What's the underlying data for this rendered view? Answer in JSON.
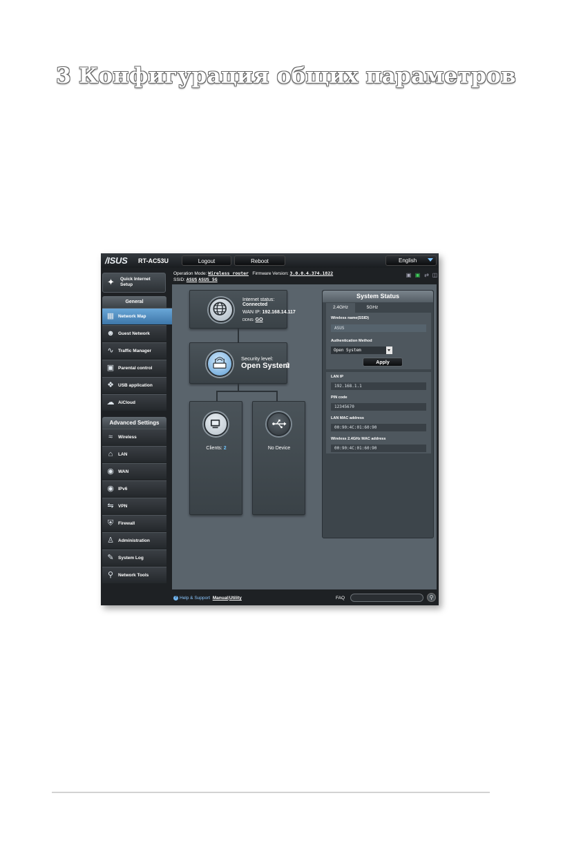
{
  "page": {
    "heading": "3 Конфигурация общих параметров"
  },
  "topbar": {
    "brand": "/ISUS",
    "model": "RT-AC53U",
    "logout": "Logout",
    "reboot": "Reboot",
    "language": "English"
  },
  "info": {
    "op_mode_label": "Operation Mode:",
    "op_mode": "Wireless router",
    "fw_label": "Firmware Version:",
    "fw": "3.0.0.4.374.1822",
    "ssid_label": "SSID:",
    "ssid1": "ASUS",
    "ssid2": "ASUS_5G"
  },
  "sidebar": {
    "qis": "Quick Internet Setup",
    "general_title": "General",
    "general": [
      {
        "label": "Network Map",
        "icon": "network-map-icon"
      },
      {
        "label": "Guest Network",
        "icon": "guest-network-icon"
      },
      {
        "label": "Traffic Manager",
        "icon": "traffic-manager-icon"
      },
      {
        "label": "Parental control",
        "icon": "lock-icon"
      },
      {
        "label": "USB application",
        "icon": "puzzle-icon"
      },
      {
        "label": "AiCloud",
        "icon": "cloud-icon"
      }
    ],
    "advanced_title": "Advanced Settings",
    "advanced": [
      {
        "label": "Wireless",
        "icon": "wifi-icon"
      },
      {
        "label": "LAN",
        "icon": "home-icon"
      },
      {
        "label": "WAN",
        "icon": "globe-icon"
      },
      {
        "label": "IPv6",
        "icon": "ipv6-globe-icon"
      },
      {
        "label": "VPN",
        "icon": "vpn-icon"
      },
      {
        "label": "Firewall",
        "icon": "shield-icon"
      },
      {
        "label": "Administration",
        "icon": "admin-icon"
      },
      {
        "label": "System Log",
        "icon": "log-icon"
      },
      {
        "label": "Network Tools",
        "icon": "tools-icon"
      }
    ]
  },
  "map": {
    "internet_status_label": "Internet status:",
    "internet_status": "Connected",
    "wan_ip_label": "WAN IP:",
    "wan_ip": "192.168.14.117",
    "ddns_label": "DDNS:",
    "ddns": "GO",
    "security_label": "Security level:",
    "security": "Open System",
    "clients_label": "Clients:",
    "clients_count": "2",
    "usb": "No Device"
  },
  "status": {
    "title": "System Status",
    "tab1": "2.4GHz",
    "tab2": "5GHz",
    "ssid_label": "Wireless name(SSID)",
    "ssid": "ASUS",
    "auth_label": "Authentication Method",
    "auth": "Open System",
    "apply": "Apply",
    "lan_ip_label": "LAN IP",
    "lan_ip": "192.168.1.1",
    "pin_label": "PIN code",
    "pin": "12345670",
    "mac_label": "LAN MAC address",
    "mac": "00:90:4C:01:60:90",
    "wmac_label": "Wireless 2.4GHz MAC address",
    "wmac": "00:90:4C:01:60:90"
  },
  "footer": {
    "help": "Help & Support",
    "manual": "Manual",
    "sep": "|",
    "utility": "Utility",
    "faq": "FAQ"
  }
}
